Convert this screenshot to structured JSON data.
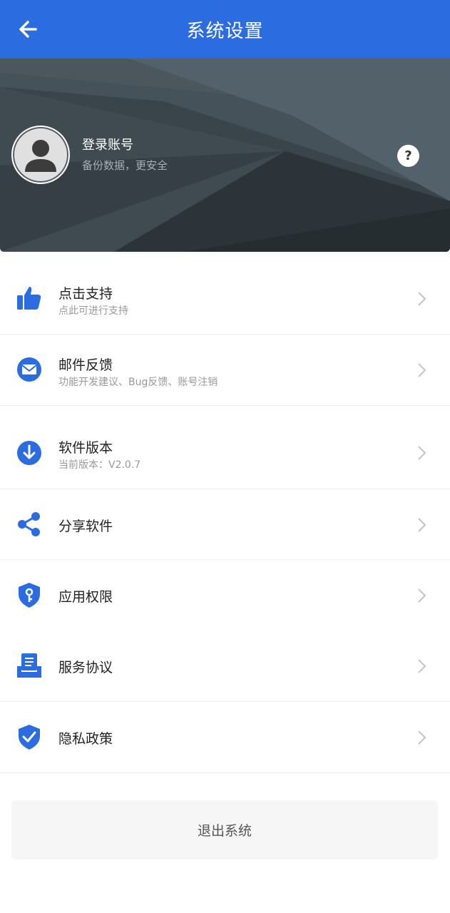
{
  "header": {
    "title": "系统设置"
  },
  "account": {
    "title": "登录账号",
    "subtitle": "备份数据，更安全",
    "help": "?"
  },
  "menu": [
    {
      "label": "点击支持",
      "sub": "点此可进行支持",
      "icon": "thumbs-up-icon"
    },
    {
      "label": "邮件反馈",
      "sub": "功能开发建议、Bug反馈、账号注销",
      "icon": "mail-icon"
    },
    {
      "label": "软件版本",
      "sub": "当前版本：V2.0.7",
      "icon": "download-icon"
    },
    {
      "label": "分享软件",
      "sub": "",
      "icon": "share-icon"
    },
    {
      "label": "应用权限",
      "sub": "",
      "icon": "shield-key-icon"
    },
    {
      "label": "服务协议",
      "sub": "",
      "icon": "document-tray-icon"
    },
    {
      "label": "隐私政策",
      "sub": "",
      "icon": "shield-check-icon"
    }
  ],
  "logout": {
    "label": "退出系统"
  },
  "colors": {
    "accent": "#2b6ce0",
    "banner": "#3c474f"
  }
}
